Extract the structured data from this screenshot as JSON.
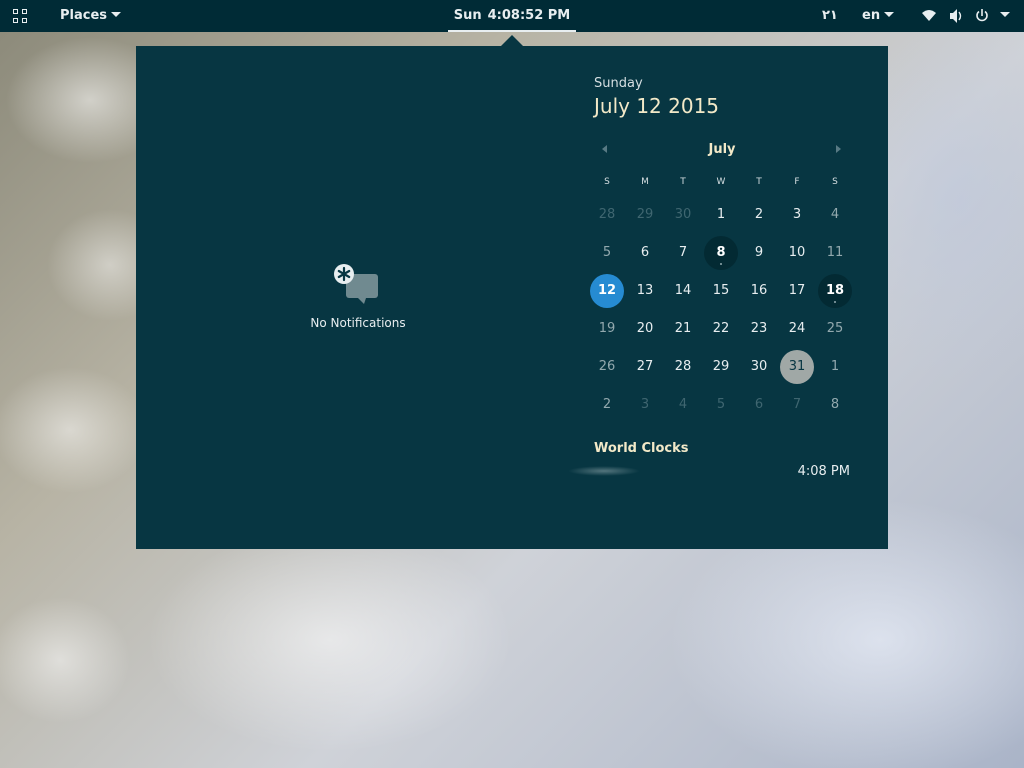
{
  "topbar": {
    "places_label": "Places",
    "clock_day": "Sun",
    "clock_time": "4:08:52 PM",
    "rtl_indicator": "٢١",
    "language": "en",
    "icons": [
      "apps-grid-icon",
      "wifi-icon",
      "volume-icon",
      "power-icon",
      "chevron-down-icon"
    ]
  },
  "notifications": {
    "empty_label": "No Notifications",
    "icon": "no-notifications-icon"
  },
  "calendar": {
    "weekday_name": "Sunday",
    "full_date": "July 12 2015",
    "month_label": "July",
    "weekday_headers": [
      "S",
      "M",
      "T",
      "W",
      "T",
      "F",
      "S"
    ],
    "weeks": [
      [
        "28",
        "29",
        "30",
        "1",
        "2",
        "3",
        "4"
      ],
      [
        "5",
        "6",
        "7",
        "8",
        "9",
        "10",
        "11"
      ],
      [
        "12",
        "13",
        "14",
        "15",
        "16",
        "17",
        "18"
      ],
      [
        "19",
        "20",
        "21",
        "22",
        "23",
        "24",
        "25"
      ],
      [
        "26",
        "27",
        "28",
        "29",
        "30",
        "31",
        "1"
      ],
      [
        "2",
        "3",
        "4",
        "5",
        "6",
        "7",
        "8"
      ]
    ],
    "today": "12",
    "selected": "31",
    "days_with_events": [
      "8",
      "18"
    ]
  },
  "world_clocks": {
    "title": "World Clocks",
    "entries": [
      {
        "time": "4:08 PM"
      }
    ]
  },
  "colors": {
    "panel": "#073642",
    "topbar": "#002b36",
    "today_accent": "#268bd2",
    "heading": "#f2e9c8"
  }
}
